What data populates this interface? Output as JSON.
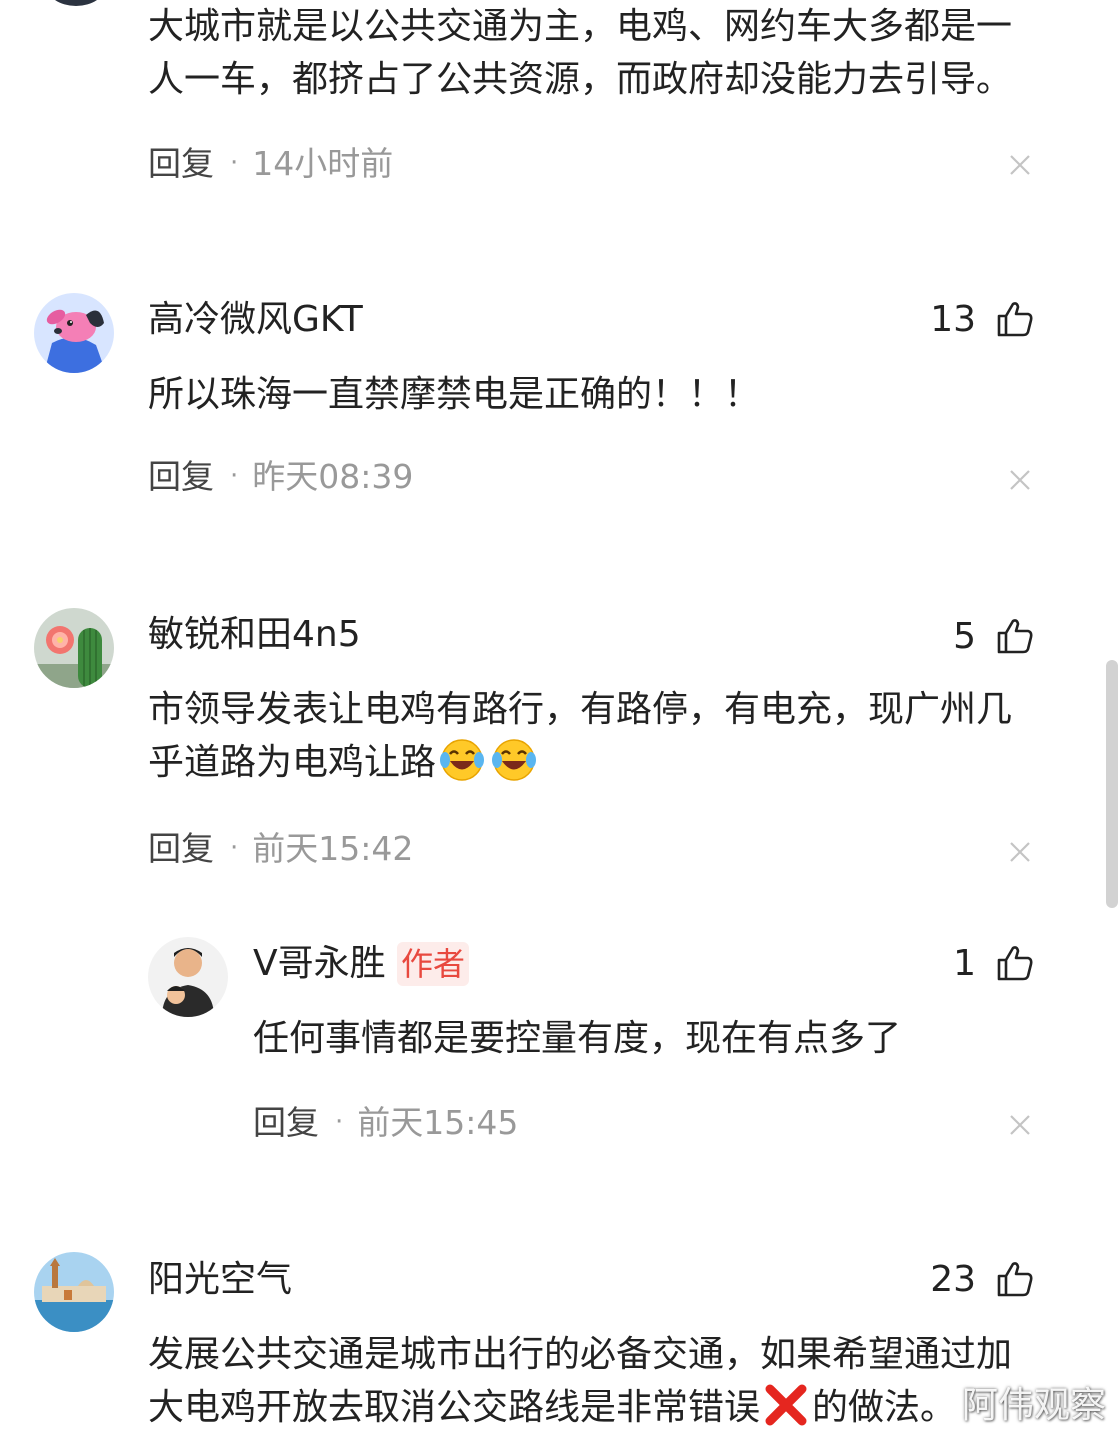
{
  "colors": {
    "text": "#222222",
    "muted": "#999999",
    "author_badge_text": "#e8493f",
    "author_badge_bg": "#fdecea"
  },
  "comments": [
    {
      "username": "",
      "avatar": "dark-avatar",
      "text_lines": [
        "大城市就是以公共交通为主，电鸡、网约车大多都是一",
        "人一车，都挤占了公共资源，而政府却没能力去引导。"
      ],
      "reply_label": "回复",
      "timestamp": "14小时前"
    },
    {
      "username": "高冷微风GKT",
      "avatar": "cartoon-dog-avatar",
      "likes": "13",
      "text": "所以珠海一直禁摩禁电是正确的！！！",
      "reply_label": "回复",
      "timestamp": "昨天08:39"
    },
    {
      "username": "敏锐和田4n5",
      "avatar": "cactus-flower-avatar",
      "likes": "5",
      "text_line1": "市领导发表让电鸡有路行，有路停，有电充，现广州几",
      "text_line2": "乎道路为电鸡让路",
      "emojis": [
        "laughing-crying-emoji",
        "laughing-crying-emoji"
      ],
      "reply_label": "回复",
      "timestamp": "前天15:42",
      "replies": [
        {
          "username": "V哥永胜",
          "badge": "作者",
          "avatar": "two-people-avatar",
          "likes": "1",
          "text": "任何事情都是要控量有度，现在有点多了",
          "reply_label": "回复",
          "timestamp": "前天15:45"
        }
      ]
    },
    {
      "username": "阳光空气",
      "avatar": "seaside-town-avatar",
      "likes": "23",
      "text_line1": "发展公共交通是城市出行的必备交通，如果希望通过加",
      "text_line2_before": "大电鸡开放去取消公交路线是非常错误",
      "text_line2_emoji": "red-cross-mark-emoji",
      "text_line2_after": "的做法。"
    }
  ],
  "watermark": "阿伟观察"
}
